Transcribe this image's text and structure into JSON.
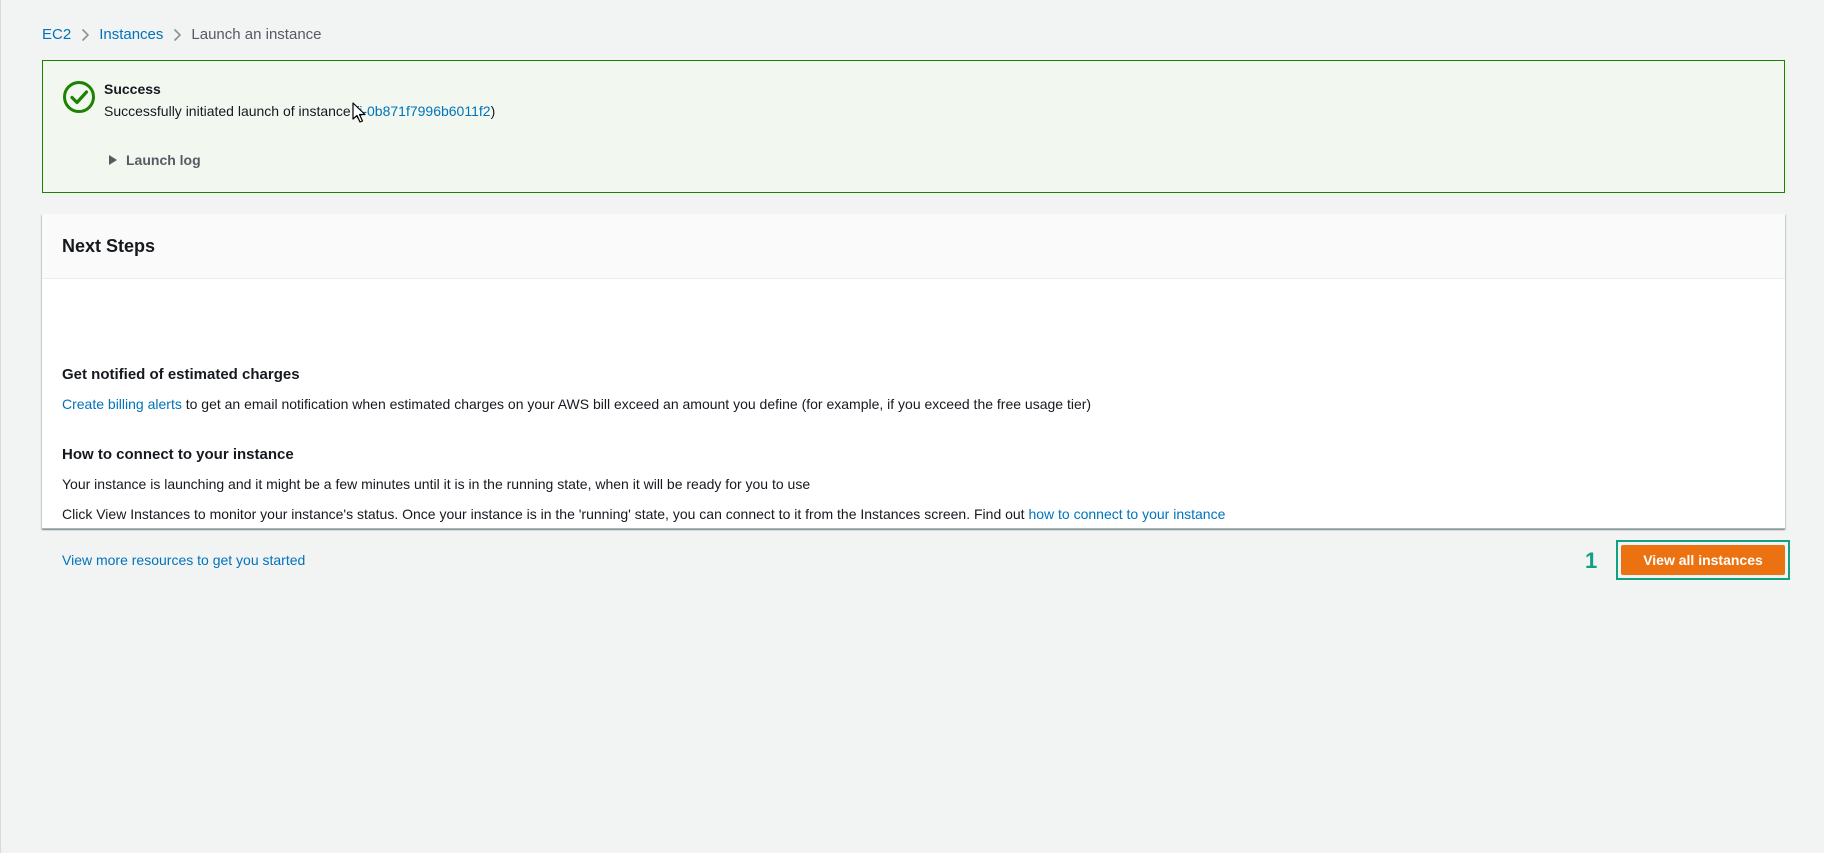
{
  "breadcrumb": {
    "items": [
      {
        "label": "EC2"
      },
      {
        "label": "Instances"
      }
    ],
    "current": "Launch an instance"
  },
  "flash": {
    "type": "success",
    "title": "Success",
    "message_prefix": "Successfully initiated launch of instance (",
    "instance_id": "i-0b871f7996b6011f2",
    "message_suffix": ")",
    "launch_log_label": "Launch log",
    "icon": "check-circle-icon"
  },
  "next_steps": {
    "title": "Next Steps",
    "billing": {
      "heading": "Get notified of estimated charges",
      "link": "Create billing alerts",
      "text": " to get an email notification when estimated charges on your AWS bill exceed an amount you define (for example, if you exceed the free usage tier)"
    },
    "connect": {
      "heading": "How to connect to your instance",
      "line1": "Your instance is launching and it might be a few minutes until it is in the running state, when it will be ready for you to use",
      "line2_text": "Click View Instances to monitor your instance's status. Once your instance is in the 'running' state, you can connect to it from the Instances screen. Find out ",
      "line2_link": "how to connect to your instance"
    },
    "resources_link": "View more resources to get you started"
  },
  "footer": {
    "step_number": "1",
    "view_all_label": "View all instances"
  },
  "colors": {
    "success": "#1d8102",
    "success_bg": "#f2f8f0",
    "link": "#0073bb",
    "primary_button": "#ec7211",
    "highlight": "#12a082"
  }
}
